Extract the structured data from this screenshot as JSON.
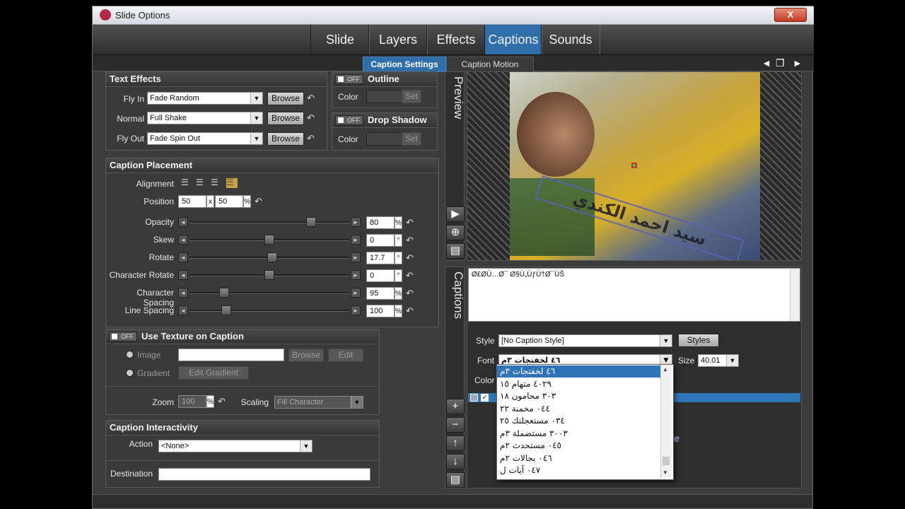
{
  "window": {
    "title": "Slide Options",
    "close_label": "X"
  },
  "main_tabs": [
    {
      "label": "Slide",
      "active": false
    },
    {
      "label": "Layers",
      "active": false
    },
    {
      "label": "Effects",
      "active": false
    },
    {
      "label": "Captions",
      "active": true
    },
    {
      "label": "Sounds",
      "active": false
    }
  ],
  "sub_tabs": [
    {
      "label": "Caption Settings",
      "active": true
    },
    {
      "label": "Caption Motion",
      "active": false
    }
  ],
  "nav": {
    "prev": "◄",
    "restore": "❐",
    "next": "►"
  },
  "text_effects": {
    "title": "Text Effects",
    "browse_label": "Browse",
    "rows": [
      {
        "label": "Fly In",
        "value": "Fade Random"
      },
      {
        "label": "Normal",
        "value": "Full Shake"
      },
      {
        "label": "Fly Out",
        "value": "Fade Spin Out"
      }
    ]
  },
  "outline": {
    "title": "Outline",
    "toggle": "OFF",
    "color_label": "Color",
    "set_label": "Set"
  },
  "drop_shadow": {
    "title": "Drop Shadow",
    "toggle": "OFF",
    "color_label": "Color",
    "set_label": "Set"
  },
  "placement": {
    "title": "Caption Placement",
    "alignment_label": "Alignment",
    "position_label": "Position",
    "position_x": "50",
    "position_y": "50",
    "position_x_sep": "x",
    "position_unit": "%",
    "sliders": [
      {
        "label": "Opacity",
        "value": "80",
        "unit": "%",
        "level": 0.78
      },
      {
        "label": "Skew",
        "value": "0",
        "unit": "°",
        "level": 0.5
      },
      {
        "label": "Rotate",
        "value": "17.7",
        "unit": "°",
        "level": 0.52
      },
      {
        "label": "Character Rotate",
        "value": "0",
        "unit": "°",
        "level": 0.5
      },
      {
        "label": "Character Spacing",
        "value": "95",
        "unit": "%",
        "level": 0.2
      },
      {
        "label": "Line Spacing",
        "value": "100",
        "unit": "%",
        "level": 0.21
      }
    ]
  },
  "texture": {
    "title": "Use Texture on Caption",
    "toggle": "OFF",
    "image_label": "Image",
    "gradient_label": "Gradient",
    "browse_label": "Browse",
    "edit_label": "Edit",
    "edit_gradient_label": "Edit Gradient",
    "zoom_label": "Zoom",
    "zoom_value": "100",
    "zoom_unit": "%",
    "scaling_label": "Scaling",
    "scaling_value": "Fill Character"
  },
  "interactivity": {
    "title": "Caption Interactivity",
    "action_label": "Action",
    "action_value": "<None>",
    "destination_label": "Destination",
    "destination_value": ""
  },
  "preview": {
    "tab_label": "Preview",
    "caption_overlay_text": "سيد احمد الكندي"
  },
  "captions": {
    "tab_label": "Captions",
    "text": "Ø£Ø­Ù…Ø¯ Ø§Ù„ÙƒÙ†Ø¯ÙŠ",
    "style_label": "Style",
    "style_value": "[No Caption Style]",
    "styles_button": "Styles",
    "font_label": "Font",
    "font_value": "٤٦ لخفتجات ٣م",
    "size_label": "Size",
    "size_value": "40.01",
    "color_label": "Color",
    "font_options": [
      "٤٦ لخفتجات ٣م",
      "٤٠٢٩ متهام ١٥",
      "٣٠٣ محامون ١٨",
      "٠٤٤ مخمنة ٢٢",
      "٠٣٤ مستعجلتك ٢٥",
      "٣٠٠٣ مستضملة ٣م",
      "٠٤٥ مستحدث ٢م",
      "٠٤٦ بجالات ٢م",
      "٠٤٧ آيات ل"
    ],
    "hover_preview": "Love"
  },
  "colors": {
    "accent": "#2f6ea8",
    "panel": "#3a3a3a",
    "window": "#3c3c3c"
  }
}
